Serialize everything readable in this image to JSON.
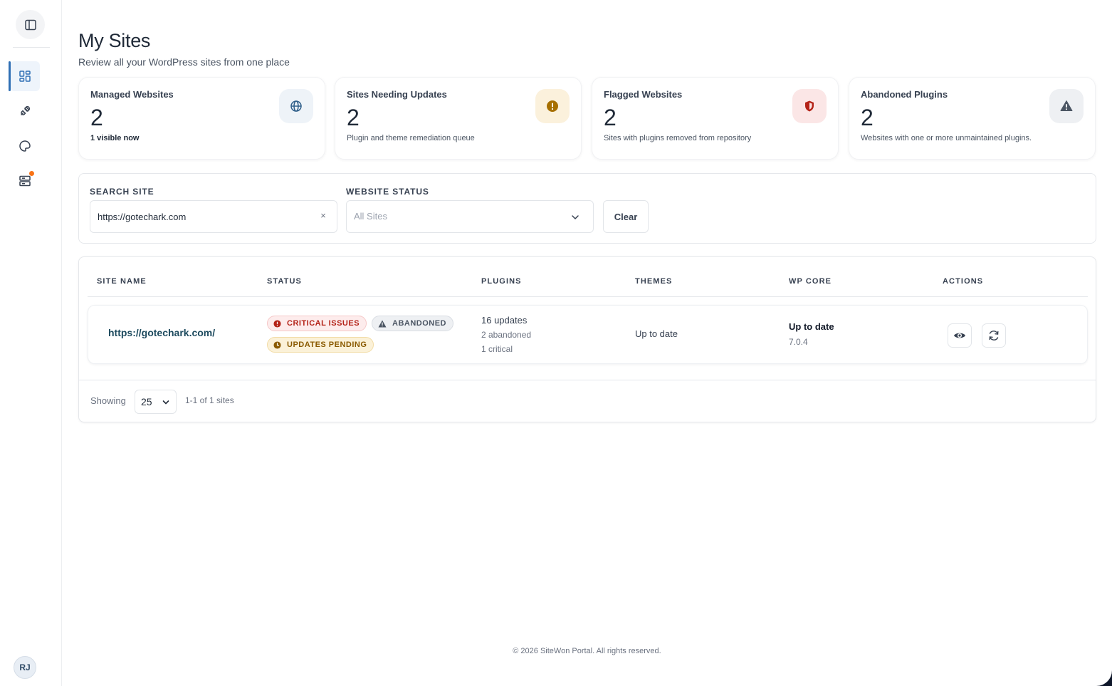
{
  "sidebar": {
    "toggle_icon": "panel-toggle-icon",
    "items": [
      {
        "name": "dashboard",
        "icon": "grid-icon",
        "active": true
      },
      {
        "name": "plugins",
        "icon": "plug-icon",
        "active": false
      },
      {
        "name": "themes",
        "icon": "palette-icon",
        "active": false
      },
      {
        "name": "servers",
        "icon": "server-icon",
        "active": false,
        "has_notification": true
      }
    ],
    "avatar_initials": "RJ"
  },
  "header": {
    "title": "My Sites",
    "subtitle": "Review all your WordPress sites from one place"
  },
  "stats": [
    {
      "title": "Managed Websites",
      "value": "2",
      "sub": "1 visible now",
      "icon": "globe-icon",
      "icon_bg": "#eef3f8",
      "icon_color": "#2f5f8a"
    },
    {
      "title": "Sites Needing Updates",
      "value": "2",
      "sub": "Plugin and theme remediation queue",
      "icon": "alert-circle-icon",
      "icon_bg": "#fbf1dc",
      "icon_color": "#a66f00"
    },
    {
      "title": "Flagged Websites",
      "value": "2",
      "sub": "Sites with plugins removed from repository",
      "icon": "shield-icon",
      "icon_bg": "#fbe6e6",
      "icon_color": "#b42318"
    },
    {
      "title": "Abandoned Plugins",
      "value": "2",
      "sub": "Websites with one or more unmaintained plugins.",
      "icon": "warning-triangle-icon",
      "icon_bg": "#eef0f3",
      "icon_color": "#4b5563"
    }
  ],
  "filters": {
    "search_label": "SEARCH SITE",
    "search_value": "https://gotechark.com",
    "search_clear": "×",
    "status_label": "WEBSITE STATUS",
    "status_value": "All Sites",
    "clear_label": "Clear"
  },
  "table": {
    "columns": [
      "SITE NAME",
      "STATUS",
      "PLUGINS",
      "THEMES",
      "WP CORE",
      "ACTIONS"
    ],
    "rows": [
      {
        "site": "https://gotechark.com/",
        "badges": {
          "critical": "CRITICAL ISSUES",
          "abandoned": "ABANDONED",
          "pending": "UPDATES PENDING"
        },
        "plugins": {
          "updates": "16 updates",
          "abandoned": "2 abandoned",
          "critical": "1 critical"
        },
        "themes": "Up to date",
        "wp_core": {
          "status": "Up to date",
          "version": "7.0.4"
        },
        "actions": [
          "view-icon",
          "refresh-icon"
        ]
      }
    ],
    "footer": {
      "showing_label": "Showing",
      "page_size": "25",
      "range": "1-1 of 1 sites"
    }
  },
  "footer": {
    "copyright": "© 2026 SiteWon Portal. All rights reserved."
  },
  "colors": {
    "accent": "#2f6fb5",
    "notification": "#f97316"
  }
}
